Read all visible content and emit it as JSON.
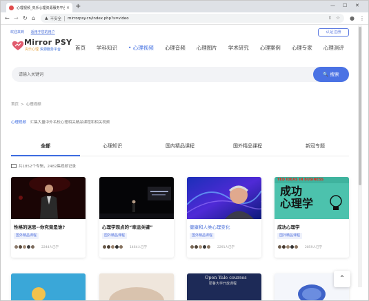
{
  "browser": {
    "tab_title": "心理视频_央乐心理资源服务平台",
    "tab_close": "×",
    "new_tab": "+",
    "window_minimize": "—",
    "window_maximize": "☐",
    "window_close": "✕",
    "back": "←",
    "forward": "→",
    "reload": "↻",
    "home": "⌂",
    "security_label": "不安全",
    "url": "mirrorpsy.cn/index.php?s=video",
    "icon_share": "⇪",
    "icon_star": "☆",
    "icon_profile": "●",
    "icon_menu": "⋮"
  },
  "top": {
    "welcome": "欢迎来到",
    "user_link": "适用于您的用户",
    "login_button": "认证注册"
  },
  "logo": {
    "name": "Mirror PSY",
    "sub_a": "央乐心理",
    "sub_b": "资源服务平台"
  },
  "nav": [
    {
      "label": "首页",
      "active": false
    },
    {
      "label": "学科知识",
      "active": false
    },
    {
      "label": "• 心理视频",
      "active": true
    },
    {
      "label": "心理音频",
      "active": false
    },
    {
      "label": "心理图片",
      "active": false
    },
    {
      "label": "学术研究",
      "active": false
    },
    {
      "label": "心理案例",
      "active": false
    },
    {
      "label": "心理专家",
      "active": false
    },
    {
      "label": "心理测评",
      "active": false
    }
  ],
  "search": {
    "placeholder": "请输入关键词",
    "button": "🔍 搜索"
  },
  "breadcrumb": {
    "home": "首页",
    "sep": ">",
    "current": "心理视频"
  },
  "category": {
    "name": "心理视频",
    "desc": "汇集大量中外名校心理相关精品课程和相关视频"
  },
  "tabs": [
    {
      "label": "全部",
      "active": true
    },
    {
      "label": "心理知识",
      "active": false
    },
    {
      "label": "国内精品课程",
      "active": false
    },
    {
      "label": "国外精品课程",
      "active": false
    },
    {
      "label": "新冠专题",
      "active": false
    }
  ],
  "summary": "共1852个专辑，2482集视频记录",
  "cards": [
    {
      "title": "性格的迷思--你究竟是谁?",
      "title_blue": false,
      "tag": "国外精品课程",
      "learners": "2244人已学"
    },
    {
      "title": "心理学观点的“幸运关键”",
      "title_blue": false,
      "tag": "国外精品课程",
      "learners": "1464人已学"
    },
    {
      "title": "健康和人类心理变化",
      "title_blue": true,
      "tag": "国外精品课程",
      "learners": "2291人已学"
    },
    {
      "title": "成功心理学",
      "title_blue": false,
      "tag": "国外精品课程",
      "learners": "2859人已学"
    }
  ],
  "thumb_text": {
    "ted_banner": "TED IDEAS IN BUSINESS",
    "ted_big_1": "成功",
    "ted_big_2": "心理学",
    "yale_1": "Open Yale courses",
    "yale_2": "耶鲁大学开放课程"
  },
  "back_to_top": "⌃",
  "colors": {
    "accent": "#3c6be0",
    "search_button": "#4a72e4",
    "tag_bg": "#eef1fb"
  }
}
